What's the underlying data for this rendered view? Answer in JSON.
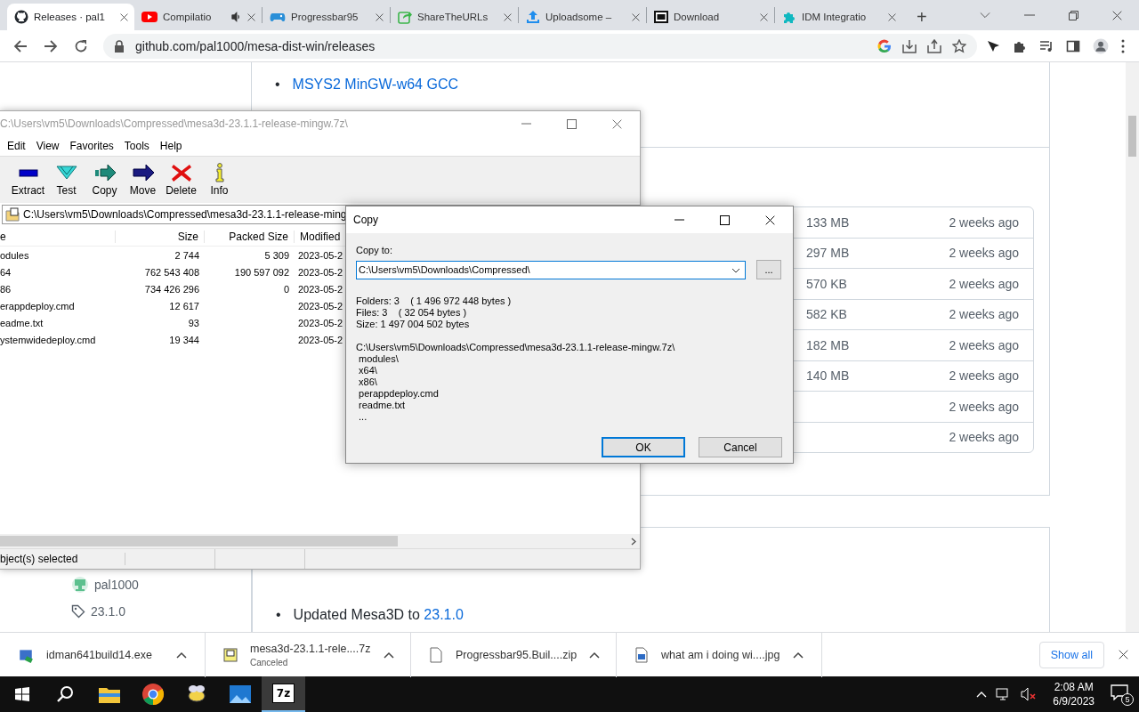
{
  "browser": {
    "tabs": [
      {
        "title": "Releases · pal1",
        "kind": "github",
        "selected": true,
        "audio": false
      },
      {
        "title": "Compilatio",
        "kind": "video",
        "selected": false,
        "audio": true
      },
      {
        "title": "Progressbar95",
        "kind": "game",
        "selected": false,
        "audio": false
      },
      {
        "title": "ShareTheURLs",
        "kind": "share",
        "selected": false,
        "audio": false
      },
      {
        "title": "Uploadsome –",
        "kind": "upload",
        "selected": false,
        "audio": false
      },
      {
        "title": "Download",
        "kind": "archive",
        "selected": false,
        "audio": false
      },
      {
        "title": "IDM Integratio",
        "kind": "puzzle",
        "selected": false,
        "audio": false
      }
    ],
    "new_tab": "+",
    "address": "github.com/pal1000/mesa-dist-win/releases"
  },
  "page": {
    "links": [
      {
        "bullet": "•",
        "text": "MSYS2 MinGW-w64 GCC"
      }
    ],
    "assets": [
      {
        "size": "133 MB",
        "time": "2 weeks ago"
      },
      {
        "size": "297 MB",
        "time": "2 weeks ago"
      },
      {
        "size": "570 KB",
        "time": "2 weeks ago"
      },
      {
        "size": "582 KB",
        "time": "2 weeks ago"
      },
      {
        "size": "182 MB",
        "time": "2 weeks ago"
      },
      {
        "size": "140 MB",
        "time": "2 weeks ago"
      },
      {
        "time": "2 weeks ago"
      },
      {
        "time": "2 weeks ago"
      }
    ],
    "release": {
      "author": "pal1000",
      "tag": "23.1.0",
      "bullet": "•",
      "note": "Updated Mesa3D to ",
      "note_link": "23.1.0"
    }
  },
  "archive_window": {
    "title": "C:\\Users\\vm5\\Downloads\\Compressed\\mesa3d-23.1.1-release-mingw.7z\\",
    "menu": [
      "Edit",
      "View",
      "Favorites",
      "Tools",
      "Help"
    ],
    "tools": [
      {
        "label": "Extract",
        "kind": "extract"
      },
      {
        "label": "Test",
        "kind": "test"
      },
      {
        "label": "Copy",
        "kind": "copy"
      },
      {
        "label": "Move",
        "kind": "move"
      },
      {
        "label": "Delete",
        "kind": "delete"
      },
      {
        "label": "Info",
        "kind": "info"
      }
    ],
    "path": "C:\\Users\\vm5\\Downloads\\Compressed\\mesa3d-23.1.1-release-ming",
    "columns": [
      "e",
      "Size",
      "Packed Size",
      "Modified"
    ],
    "rows": [
      {
        "name": "odules",
        "size": "2 744",
        "packed": "5 309",
        "modified": "2023-05-2"
      },
      {
        "name": "64",
        "size": "762 543 408",
        "packed": "190 597 092",
        "modified": "2023-05-2"
      },
      {
        "name": "86",
        "size": "734 426 296",
        "packed": "0",
        "modified": "2023-05-2"
      },
      {
        "name": "erappdeploy.cmd",
        "size": "12 617",
        "modified": "2023-05-2"
      },
      {
        "name": "eadme.txt",
        "size": "93",
        "modified": "2023-05-2"
      },
      {
        "name": "ystemwidedeploy.cmd",
        "size": "19 344",
        "modified": "2023-05-2"
      }
    ],
    "status": "bject(s) selected"
  },
  "copy_dialog": {
    "title": "Copy",
    "label": "Copy to:",
    "value": "C:\\Users\\vm5\\Downloads\\Compressed\\",
    "browse": "...",
    "summary": [
      "Folders: 3    ( 1 496 972 448 bytes )",
      "Files: 3    ( 32 054 bytes )",
      "Size: 1 497 004 502 bytes"
    ],
    "listing": [
      "C:\\Users\\vm5\\Downloads\\Compressed\\mesa3d-23.1.1-release-mingw.7z\\",
      " modules\\",
      " x64\\",
      " x86\\",
      " perappdeploy.cmd",
      " readme.txt",
      " ..."
    ],
    "buttons": [
      {
        "label": "OK",
        "default": true
      },
      {
        "label": "Cancel",
        "default": false
      }
    ]
  },
  "downloads": {
    "items": [
      {
        "name": "idman641build14.exe",
        "kind": "installer"
      },
      {
        "name": "mesa3d-23.1.1-rele....7z",
        "status": "Canceled",
        "kind": "archive"
      },
      {
        "name": "Progressbar95.Buil....zip",
        "kind": "file"
      },
      {
        "name": "what am i doing wi....jpg",
        "kind": "image"
      }
    ],
    "show_all": "Show all"
  },
  "taskbar": {
    "apps": [
      {
        "kind": "explorer",
        "selected": false
      },
      {
        "kind": "chrome",
        "selected": false
      },
      {
        "kind": "bee",
        "selected": false
      },
      {
        "kind": "photos",
        "selected": false
      },
      {
        "kind": "sevenzip",
        "label": "7z",
        "selected": true
      }
    ],
    "time": "2:08 AM",
    "date": "6/9/2023",
    "notifications": "5"
  }
}
